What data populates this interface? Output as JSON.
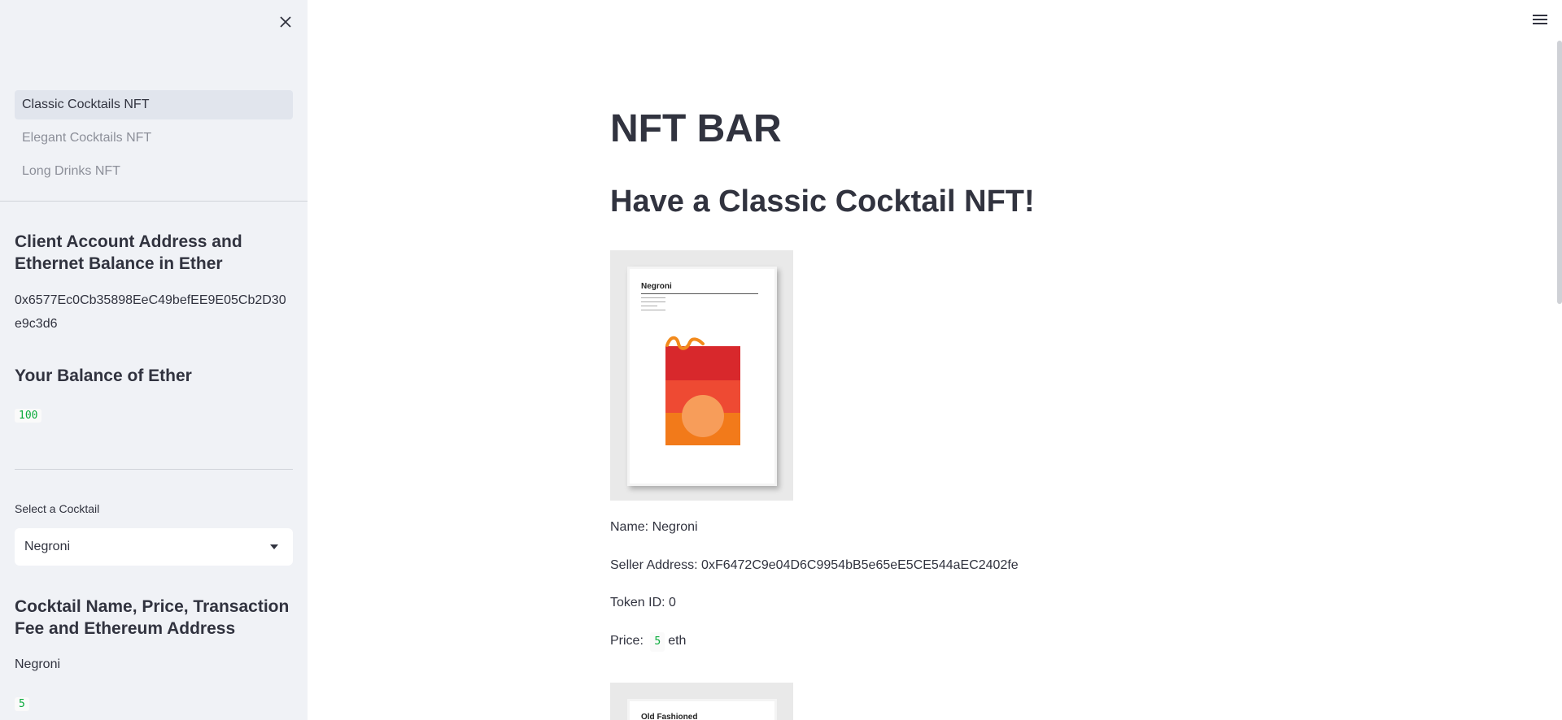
{
  "sidebar": {
    "nav_items": [
      {
        "label": "Classic Cocktails NFT",
        "active": true
      },
      {
        "label": "Elegant Cocktails NFT",
        "active": false
      },
      {
        "label": "Long Drinks NFT",
        "active": false
      }
    ],
    "account_heading": "Client Account Address and Ethernet Balance in Ether",
    "account_address": "0x6577Ec0Cb35898EeC49befEE9E05Cb2D30e9c3d6",
    "balance_heading": "Your Balance of Ether",
    "balance_value": "100",
    "select_label": "Select a Cocktail",
    "select_value": "Negroni",
    "details_heading": "Cocktail Name, Price, Transaction Fee and Ethereum Address",
    "details_name": "Negroni",
    "details_price": "5"
  },
  "main": {
    "title": "NFT BAR",
    "subtitle": "Have a Classic Cocktail NFT!",
    "nft": {
      "poster_title": "Negroni",
      "name_line": "Name: Negroni",
      "seller_line": "Seller Address: 0xF6472C9e04D6C9954bB5e65eE5CE544aEC2402fe",
      "token_line": "Token ID: 0",
      "price_prefix": "Price:",
      "price_value": "5",
      "price_unit": "eth"
    },
    "next_poster_title": "Old Fashioned"
  },
  "colors": {
    "sidebar_bg": "#f0f2f6",
    "code_green": "#09ab3b",
    "text": "#31333f"
  }
}
